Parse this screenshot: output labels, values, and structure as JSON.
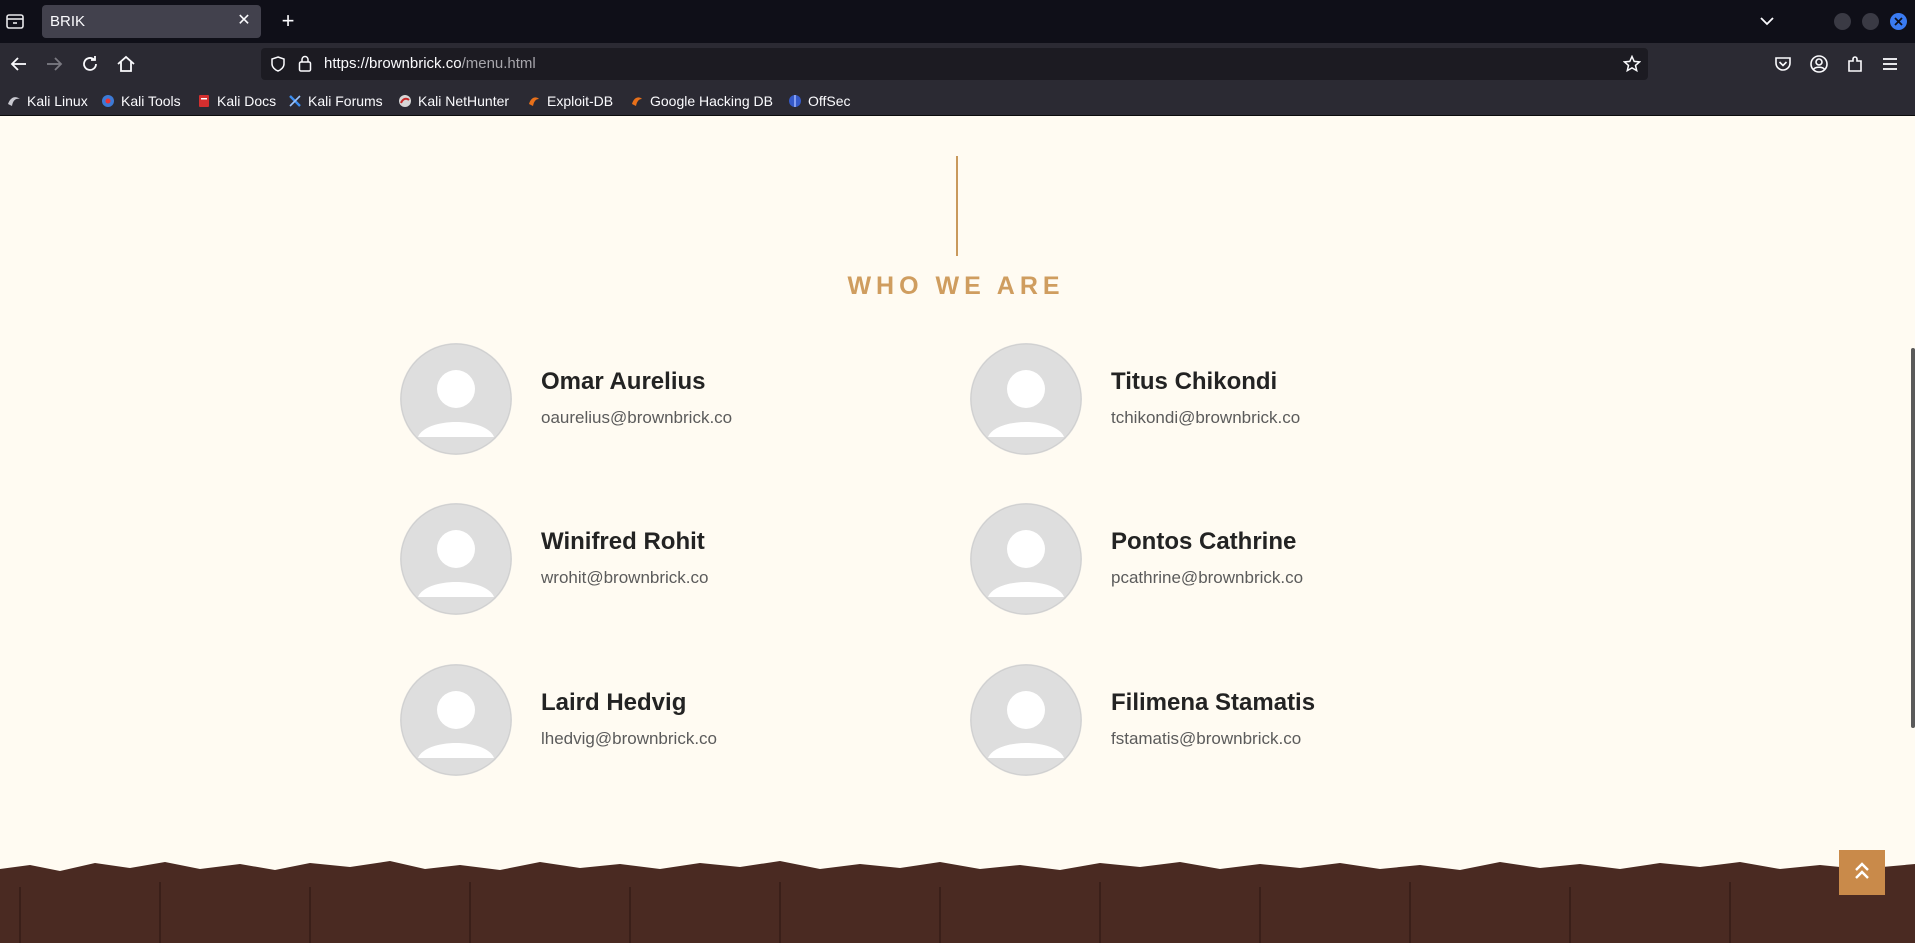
{
  "browser": {
    "tab_title": "BRIK",
    "url_host": "https://brownbrick.co",
    "url_path": "/menu.html",
    "bookmarks": [
      {
        "label": "Kali Linux",
        "icon": "kali-dragon-icon"
      },
      {
        "label": "Kali Tools",
        "icon": "kali-tools-icon"
      },
      {
        "label": "Kali Docs",
        "icon": "kali-docs-icon"
      },
      {
        "label": "Kali Forums",
        "icon": "kali-forums-icon"
      },
      {
        "label": "Kali NetHunter",
        "icon": "kali-nethunter-icon"
      },
      {
        "label": "Exploit-DB",
        "icon": "exploit-db-icon"
      },
      {
        "label": "Google Hacking DB",
        "icon": "ghdb-icon"
      },
      {
        "label": "OffSec",
        "icon": "offsec-icon"
      }
    ]
  },
  "section": {
    "title": "WHO WE ARE"
  },
  "team": [
    {
      "name": "Omar Aurelius",
      "email": "oaurelius@brownbrick.co"
    },
    {
      "name": "Titus Chikondi",
      "email": "tchikondi@brownbrick.co"
    },
    {
      "name": "Winifred Rohit",
      "email": "wrohit@brownbrick.co"
    },
    {
      "name": "Pontos Cathrine",
      "email": "pcathrine@brownbrick.co"
    },
    {
      "name": "Laird Hedvig",
      "email": "lhedvig@brownbrick.co"
    },
    {
      "name": "Filimena Stamatis",
      "email": "fstamatis@brownbrick.co"
    }
  ],
  "colors": {
    "page_bg": "#fffbf2",
    "accent": "#cf9d5f",
    "footer_brick": "#4a2a22",
    "back_to_top": "#c98a4a"
  }
}
